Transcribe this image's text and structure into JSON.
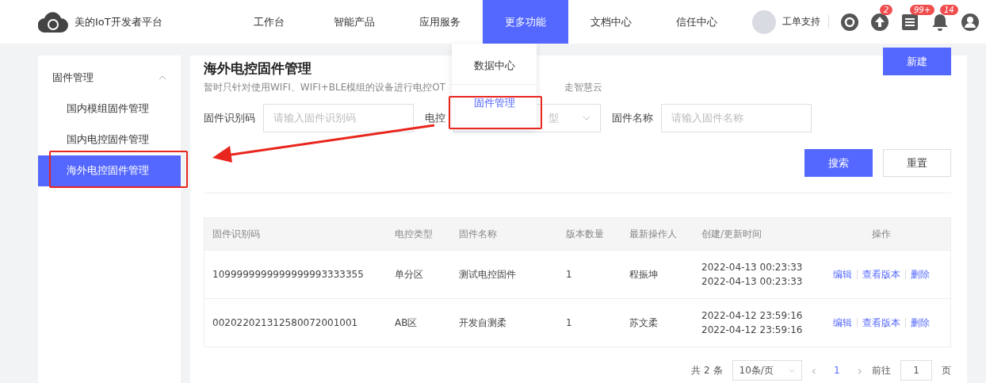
{
  "header": {
    "brand": "美的IoT开发者平台",
    "nav": [
      {
        "label": "工作台",
        "selected": false
      },
      {
        "label": "智能产品",
        "selected": false
      },
      {
        "label": "应用服务",
        "selected": false
      },
      {
        "label": "更多功能",
        "selected": true
      },
      {
        "label": "文档中心",
        "selected": false
      },
      {
        "label": "信任中心",
        "selected": false
      }
    ],
    "support": "工单支持",
    "icons": [
      {
        "kind": "refresh"
      },
      {
        "kind": "upload",
        "badge": "2"
      },
      {
        "kind": "list",
        "badge": "99+"
      },
      {
        "kind": "bell",
        "badge": "14"
      },
      {
        "kind": "user"
      }
    ]
  },
  "dropdown": {
    "items": [
      {
        "label": "数据中心",
        "selected": false
      },
      {
        "label": "固件管理",
        "selected": true
      }
    ]
  },
  "sidebar": {
    "group": "固件管理",
    "expanded": true,
    "items": [
      {
        "label": "国内模组固件管理",
        "selected": false
      },
      {
        "label": "国内电控固件管理",
        "selected": false
      },
      {
        "label": "海外电控固件管理",
        "selected": true
      }
    ]
  },
  "page": {
    "title": "海外电控固件管理",
    "description_start": "暂时只针对使用WIFI、WIFI+BLE模组的设备进行电控OT",
    "description_end": "走智慧云",
    "new_button": "新建"
  },
  "filters": [
    {
      "kind": "input",
      "label": "固件识别码",
      "placeholder": "请输入固件识别码"
    },
    {
      "kind": "select",
      "label": "电控",
      "placeholder": "型"
    },
    {
      "kind": "input",
      "label": "固件名称",
      "placeholder": "请输入固件名称"
    }
  ],
  "search_button": "搜索",
  "reset_button": "重置",
  "table": {
    "columns": [
      "固件识别码",
      "电控类型",
      "固件名称",
      "版本数量",
      "最新操作人",
      "创建/更新时间",
      "操作"
    ],
    "rows": [
      {
        "cells": [
          "1099999999999999993333355",
          "单分区",
          "测试电控固件",
          "1",
          "程振坤"
        ],
        "times": [
          "2022-04-13 00:23:33",
          "2022-04-13 00:23:33"
        ],
        "actions": [
          "编辑",
          "查看版本",
          "删除"
        ]
      },
      {
        "cells": [
          "002022021312580072001001",
          "AB区",
          "开发自测柔",
          "1",
          "苏文柔"
        ],
        "times": [
          "2022-04-12 23:59:16",
          "2022-04-12 23:59:16"
        ],
        "actions": [
          "编辑",
          "查看版本",
          "删除"
        ]
      }
    ]
  },
  "pagination": {
    "total": "共 2 条",
    "page_size": "10条/页",
    "prev": "‹",
    "pages": [
      {
        "label": "1",
        "selected": true
      }
    ],
    "next": "›",
    "goto_label": "前往",
    "goto_value": "1",
    "goto_suffix": "页"
  }
}
